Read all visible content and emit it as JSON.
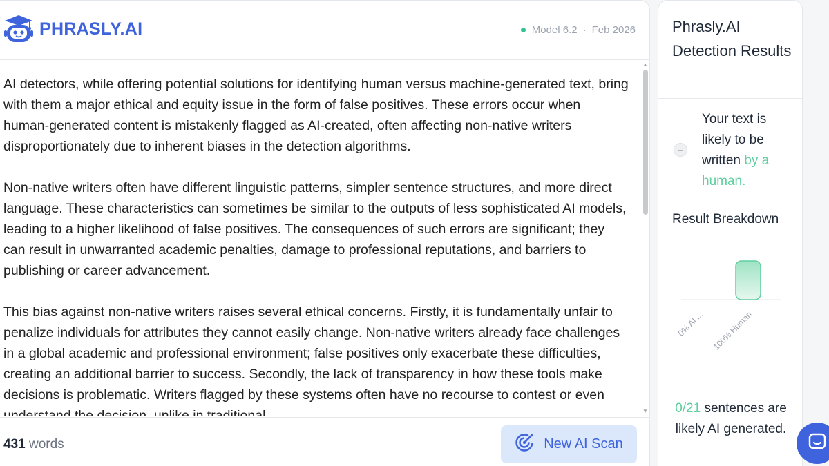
{
  "header": {
    "logo_text": "PHRASLY.AI",
    "model": "Model 6.2",
    "separator": "·",
    "date": "Feb 2026"
  },
  "document": {
    "paragraphs": [
      "AI detectors, while offering potential solutions for identifying human versus machine-generated text, bring with them a major ethical and equity issue in the form of false positives. These errors occur when human-generated content is mistakenly flagged as AI-created, often affecting non-native writers disproportionately due to inherent biases in the detection algorithms.",
      "Non-native writers often have different linguistic patterns, simpler sentence structures, and more direct language. These characteristics can sometimes be similar to the outputs of less sophisticated AI models, leading to a higher likelihood of false positives. The consequences of such errors are significant; they can result in unwarranted academic penalties, damage to professional reputations, and barriers to publishing or career advancement.",
      "This bias against non-native writers raises several ethical concerns. Firstly, it is fundamentally unfair to penalize individuals for attributes they cannot easily change. Non-native writers already face challenges in a global academic and professional environment; false positives only exacerbate these difficulties, creating an additional barrier to success. Secondly, the lack of transparency in how these tools make decisions is problematic. Writers flagged by these systems often have no recourse to contest or even understand the decision, unlike in traditional"
    ]
  },
  "footer": {
    "word_count": "431",
    "word_label": " words",
    "scan_button": "New AI Scan"
  },
  "results": {
    "title": "Phrasly.AI Detection Results",
    "verdict_prefix": "Your text is likely to be written ",
    "verdict_highlight": "by a human.",
    "breakdown_title": "Result Breakdown",
    "summary_fraction": "0/21",
    "summary_text_1": " sentences are likely ",
    "summary_bold": "AI",
    "summary_text_2": " generated."
  },
  "chart_data": {
    "type": "bar",
    "categories": [
      "0% AI ...",
      "100% Human"
    ],
    "values": [
      0,
      100
    ],
    "ylim": [
      0,
      100
    ],
    "colors": [
      "#5fcf9f",
      "#5fcf9f"
    ]
  },
  "colors": {
    "accent": "#3e63dd",
    "human_green": "#5fcf9f",
    "status_dot": "#34c38f"
  },
  "icons": {
    "logo": "robot-graduate-icon",
    "scan": "radar-scan-icon",
    "chat": "chat-icon"
  }
}
